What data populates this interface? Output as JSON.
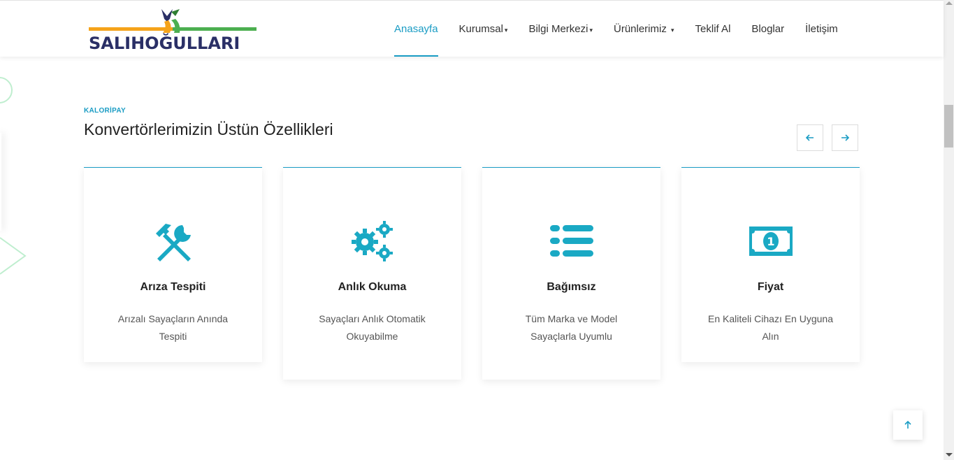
{
  "brand": {
    "name": "SALIHOĞULLARI",
    "colors": {
      "orange": "#f5a31a",
      "green": "#4caf50",
      "navy": "#2a2f66"
    }
  },
  "nav": {
    "items": [
      {
        "label": "Anasayfa",
        "active": true,
        "dropdown": false
      },
      {
        "label": "Kurumsal",
        "dropdown": true
      },
      {
        "label": "Bilgi Merkezi",
        "dropdown": true
      },
      {
        "label": "Ürünlerimiz",
        "dropdown": true
      },
      {
        "label": "Teklif Al",
        "dropdown": false
      },
      {
        "label": "Bloglar",
        "dropdown": false
      },
      {
        "label": "İletişim",
        "dropdown": false
      }
    ],
    "accent": "#1a9cc4"
  },
  "section": {
    "kicker": "KALORİPAY",
    "title": "Konvertörlerimizin Üstün Özellikleri",
    "prev_icon": "arrow-left-icon",
    "next_icon": "arrow-right-icon"
  },
  "cards": [
    {
      "icon": "tools-icon",
      "title": "Arıza Tespiti",
      "desc": "Arızalı Sayaçların Anında Tespiti"
    },
    {
      "icon": "gears-icon",
      "title": "Anlık Okuma",
      "desc": "Sayaçları Anlık Otomatik Okuyabilme"
    },
    {
      "icon": "list-icon",
      "title": "Bağımsız",
      "desc": "Tüm Marka ve Model Sayaçlarla Uyumlu"
    },
    {
      "icon": "banknote-icon",
      "title": "Fiyat",
      "desc": "En Kaliteli Cihazı En Uyguna Alın"
    }
  ],
  "back_to_top_icon": "arrow-up-icon",
  "icon_color": "#1aa9c4"
}
